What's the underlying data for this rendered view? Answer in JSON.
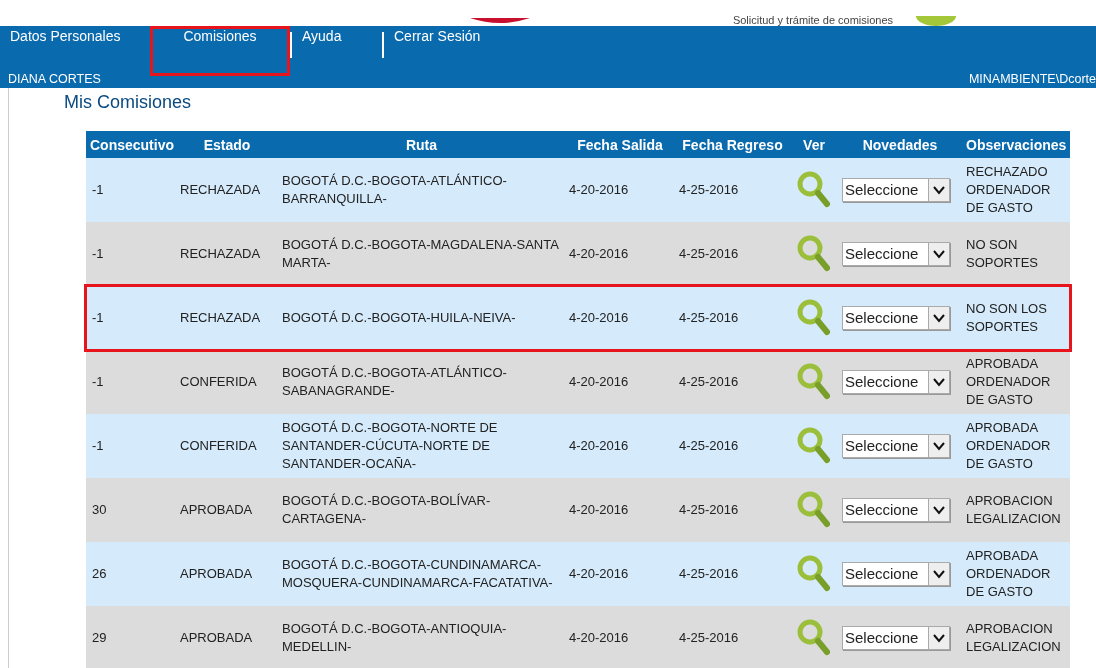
{
  "header": {
    "subtitle": "Solicitud y trámite de comisiones"
  },
  "nav": {
    "items": [
      {
        "label": "Datos Personales",
        "highlighted": false
      },
      {
        "label": "Comisiones",
        "highlighted": true
      },
      {
        "label": "Ayuda",
        "highlighted": false
      },
      {
        "label": "Cerrar Sesión",
        "highlighted": false
      }
    ],
    "user_name": "DIANA CORTES",
    "account": "MINAMBIENTE\\Dcorte"
  },
  "page_title": "Mis Comisiones",
  "table": {
    "columns": [
      "Consecutivo",
      "Estado",
      "Ruta",
      "Fecha Salida",
      "Fecha Regreso",
      "Ver",
      "Novedades",
      "Observaciones"
    ],
    "rows": [
      {
        "consecutivo": "-1",
        "estado": "RECHAZADA",
        "ruta": "BOGOTÁ D.C.-BOGOTA-ATLÁNTICO-BARRANQUILLA-",
        "fecha_salida": "4-20-2016",
        "fecha_regreso": "4-25-2016",
        "novedades": "Seleccione",
        "observaciones": "RECHAZADO ORDENADOR DE GASTO",
        "highlighted": false
      },
      {
        "consecutivo": "-1",
        "estado": "RECHAZADA",
        "ruta": "BOGOTÁ D.C.-BOGOTA-MAGDALENA-SANTA MARTA-",
        "fecha_salida": "4-20-2016",
        "fecha_regreso": "4-25-2016",
        "novedades": "Seleccione",
        "observaciones": "NO SON SOPORTES",
        "highlighted": false
      },
      {
        "consecutivo": "-1",
        "estado": "RECHAZADA",
        "ruta": "BOGOTÁ D.C.-BOGOTA-HUILA-NEIVA-",
        "fecha_salida": "4-20-2016",
        "fecha_regreso": "4-25-2016",
        "novedades": "Seleccione",
        "observaciones": "NO SON LOS SOPORTES",
        "highlighted": true
      },
      {
        "consecutivo": "-1",
        "estado": "CONFERIDA",
        "ruta": "BOGOTÁ D.C.-BOGOTA-ATLÁNTICO-SABANAGRANDE-",
        "fecha_salida": "4-20-2016",
        "fecha_regreso": "4-25-2016",
        "novedades": "Seleccione",
        "observaciones": "APROBADA ORDENADOR DE GASTO",
        "highlighted": false
      },
      {
        "consecutivo": "-1",
        "estado": "CONFERIDA",
        "ruta": "BOGOTÁ D.C.-BOGOTA-NORTE DE SANTANDER-CÚCUTA-NORTE DE SANTANDER-OCAÑA-",
        "fecha_salida": "4-20-2016",
        "fecha_regreso": "4-25-2016",
        "novedades": "Seleccione",
        "observaciones": "APROBADA ORDENADOR DE GASTO",
        "highlighted": false
      },
      {
        "consecutivo": "30",
        "estado": "APROBADA",
        "ruta": "BOGOTÁ D.C.-BOGOTA-BOLÍVAR-CARTAGENA-",
        "fecha_salida": "4-20-2016",
        "fecha_regreso": "4-25-2016",
        "novedades": "Seleccione",
        "observaciones": "APROBACION LEGALIZACION",
        "highlighted": false
      },
      {
        "consecutivo": "26",
        "estado": "APROBADA",
        "ruta": "BOGOTÁ D.C.-BOGOTA-CUNDINAMARCA-MOSQUERA-CUNDINAMARCA-FACATATIVA-",
        "fecha_salida": "4-20-2016",
        "fecha_regreso": "4-25-2016",
        "novedades": "Seleccione",
        "observaciones": "APROBADA ORDENADOR DE GASTO",
        "highlighted": false
      },
      {
        "consecutivo": "29",
        "estado": "APROBADA",
        "ruta": "BOGOTÁ D.C.-BOGOTA-ANTIOQUIA-MEDELLIN-",
        "fecha_salida": "4-20-2016",
        "fecha_regreso": "4-25-2016",
        "novedades": "Seleccione",
        "observaciones": "APROBACION LEGALIZACION",
        "highlighted": false
      }
    ]
  }
}
